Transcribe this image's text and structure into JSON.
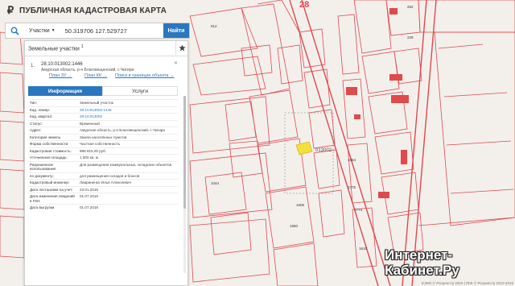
{
  "app": {
    "title": "ПУБЛИЧНАЯ КАДАСТРОВАЯ КАРТА"
  },
  "search": {
    "type_label": "Участки",
    "value": "50.319706 127.529727",
    "button": "Найти"
  },
  "panel": {
    "title": "Земельные участки",
    "count": "1",
    "result": {
      "number": "1.",
      "cad_number": "28:10:013002:1446",
      "address": "Амурская область, р-н Благовещенский, с Чигири",
      "link_zu": "План ЗУ",
      "link_kk": "План КК",
      "link_search": "Поиск в границах объекта"
    },
    "tabs": {
      "info": "Информация",
      "services": "Услуги"
    },
    "rows": [
      {
        "k": "Тип:",
        "v": "Земельный участок",
        "blue": false
      },
      {
        "k": "Кад. номер:",
        "v": "28:10:013002:1446",
        "blue": true
      },
      {
        "k": "Кад. квартал:",
        "v": "28:10:013002",
        "blue": true
      },
      {
        "k": "Статус:",
        "v": "Временный",
        "blue": false
      },
      {
        "k": "Адрес:",
        "v": "Амурская область, р-н Благовещенский, с Чигири",
        "blue": false
      },
      {
        "k": "Категория земель:",
        "v": "Земли населённых пунктов",
        "blue": false
      },
      {
        "k": "Форма собственности:",
        "v": "Частная собственность",
        "blue": false
      },
      {
        "k": "Кадастровая стоимость:",
        "v": "988 815,00 руб.",
        "blue": false
      },
      {
        "k": "Уточненная площадь:",
        "v": "1 500 кв. м",
        "blue": false
      },
      {
        "k": "Разрешенное использование:",
        "v": "Для размещения коммунальных, складских объектов",
        "blue": false
      },
      {
        "k": "по документу:",
        "v": "для размещения складов и боксов",
        "blue": false
      },
      {
        "k": "Кадастровый инженер:",
        "v": "Лавриненко Илья Алексеевич",
        "blue": false
      },
      {
        "k": "Дата постановки на учет:",
        "v": "23.01.2015",
        "blue": false
      },
      {
        "k": "Дата изменения сведений в ГКН:",
        "v": "01.07.2016",
        "blue": false
      },
      {
        "k": "Дата выгрузки",
        "v": "01.07.2016",
        "blue": false
      }
    ]
  },
  "map_labels": {
    "top": "28",
    "quarter": "013002",
    "l1": "912",
    "l2": "1044",
    "l3": "1775",
    "l4": "1774",
    "l5": "1660",
    "l6": "1605",
    "l7": "1610",
    "l8": "1654",
    "l9": "229",
    "l10": "262"
  },
  "footer": "ЕЭКО © Росреестр 2010 | ПКК © Росреестр 2010-2015",
  "watermark": {
    "line1": "Интернет-",
    "line2": "Кабинет.Ру"
  },
  "colors": {
    "accent": "#2a77c0",
    "parcel_line": "#e0484d",
    "highlight": "#f3e13a",
    "building": "#e04a4a"
  }
}
